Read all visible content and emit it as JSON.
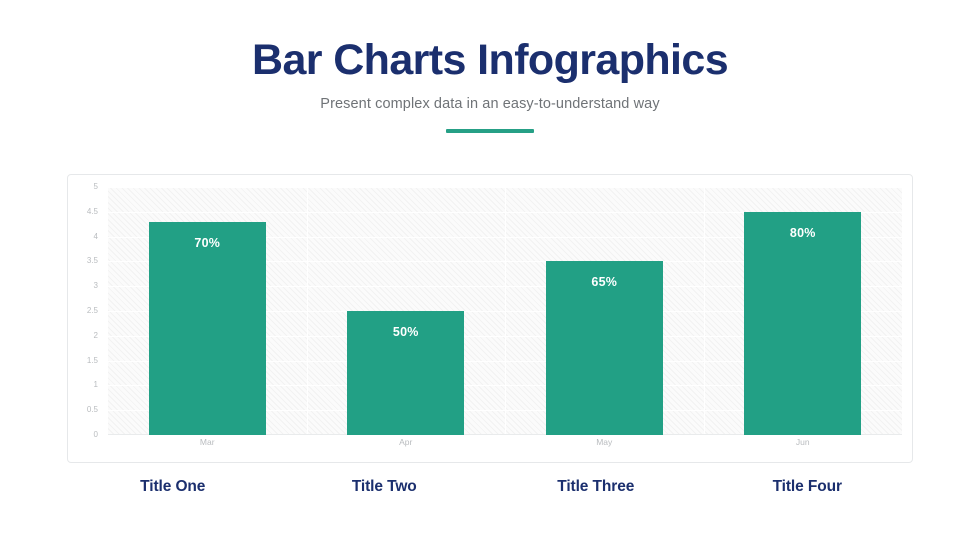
{
  "header": {
    "title": "Bar Charts Infographics",
    "subtitle": "Present complex data in an easy-to-understand way"
  },
  "colors": {
    "bar": "#22a085",
    "title": "#1b2f6e",
    "subtitle": "#6f7377",
    "accent_rule": "#26a086",
    "tick_label": "#b9bcbf",
    "card_border": "#e6e8ea",
    "plot_background": "#fbfbfb",
    "grid": "#ffffff",
    "value_label": "#ffffff"
  },
  "captions": [
    {
      "label": "Title One"
    },
    {
      "label": "Title Two"
    },
    {
      "label": "Title Three"
    },
    {
      "label": "Title Four"
    }
  ],
  "chart_data": {
    "type": "bar",
    "title": "Bar Charts Infographics",
    "subtitle": "Present complex data in an easy-to-understand way",
    "categories": [
      "Mar",
      "Apr",
      "May",
      "Jun"
    ],
    "values": [
      4.3,
      2.5,
      3.5,
      4.5
    ],
    "data_labels": [
      "70%",
      "50%",
      "65%",
      "80%"
    ],
    "series": [
      {
        "name": "",
        "values": [
          4.3,
          2.5,
          3.5,
          4.5
        ]
      }
    ],
    "xlabel": "",
    "ylabel": "",
    "ylim": [
      0,
      5
    ],
    "yticks": [
      5,
      4.5,
      4,
      3.5,
      3,
      2.5,
      2,
      1.5,
      1,
      0.5,
      0
    ],
    "ytick_labels": [
      "5",
      "4.5",
      "4",
      "3.5",
      "3",
      "2.5",
      "2",
      "1.5",
      "1",
      "0.5",
      "0"
    ],
    "grid": true,
    "legend": false,
    "bar_color": "#22a085"
  }
}
